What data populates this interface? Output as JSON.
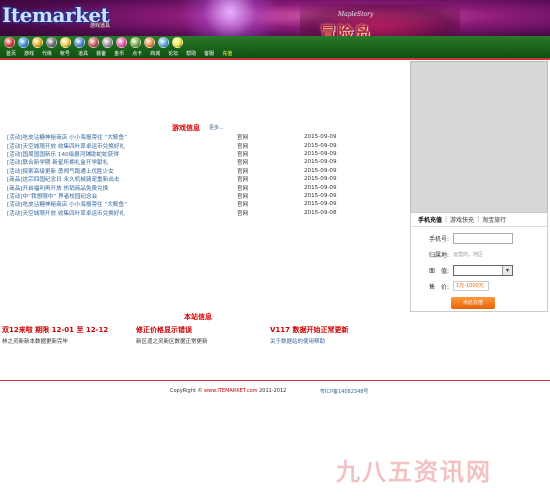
{
  "header": {
    "logo": "Itemarket",
    "logo_sub": "游戏道具",
    "game_logo": "MapleStory",
    "banner_text": "冒险岛"
  },
  "nav": {
    "icons": [
      "home-icon",
      "gem-icon",
      "coin-icon",
      "shield-icon",
      "star-icon",
      "ball-icon",
      "shop-icon",
      "sword-icon",
      "gift-icon",
      "bag-icon",
      "cup-icon",
      "ring-icon",
      "crown-icon"
    ],
    "icon_colors": [
      "#d33",
      "#3a8ee0",
      "#e8b020",
      "#6a6a6a",
      "#f4d040",
      "#48c",
      "#c55",
      "#999",
      "#e5a",
      "#7a4",
      "#e84",
      "#5ad",
      "#ee3"
    ],
    "links": [
      "首页",
      "游戏",
      "代练",
      "帐号",
      "道具",
      "装备",
      "金币",
      "点卡",
      "商城",
      "论坛",
      "帮助",
      "客服",
      "充值"
    ]
  },
  "news": {
    "title": "游戏信息",
    "more": "更多...",
    "items": [
      {
        "title": "[活动]吃皮沾糖神秘商店 小小海报旁往 “大鲸鱼”",
        "source": "官网",
        "date": "2015-09-09"
      },
      {
        "title": "[活动]天空城限开放 收集四叶草卓运币兑换好礼",
        "source": "官网",
        "date": "2015-09-09"
      },
      {
        "title": "[活动]国周国国新乐 140级爵河铺助蛇蛇获得",
        "source": "官网",
        "date": "2015-09-09"
      },
      {
        "title": "[活动]联合新学期 新星所拥礼盒开学献礼",
        "source": "官网",
        "date": "2015-09-09"
      },
      {
        "title": "[活动]探索高级更新 勇闯气跑通上优胜少女",
        "source": "官网",
        "date": "2015-09-09"
      },
      {
        "title": "[商品]这宗四国纪念日 永久机械骑宠重新出击",
        "source": "官网",
        "date": "2015-09-09"
      },
      {
        "title": "[商品]开启福利再开放 热销商品免费兑换",
        "source": "官网",
        "date": "2015-09-09"
      },
      {
        "title": "[活动]中“我想限中”  界者校园纪念会",
        "source": "官网",
        "date": "2015-09-09"
      },
      {
        "title": "[活动]吃皮沾糖神秘商店 小小海报旁往 “大鲸鱼”",
        "source": "官网",
        "date": "2015-09-09"
      },
      {
        "title": "[活动]天空城限开放 收集四叶草卓运币兑换好礼",
        "source": "官网",
        "date": "2015-09-08"
      }
    ]
  },
  "site_info": {
    "title": "本站信息",
    "notices": [
      {
        "head": "双12来啦 期限 12-01 至 12-12",
        "sub": "林之灵新新本数据更新完毕",
        "link": false
      },
      {
        "head": "修正价格显示错误",
        "sub": "新区遗之灵新区数据正常更新",
        "link": false
      },
      {
        "head": "V117 数据开始正常更新",
        "sub": "关于数据站的使用帮助",
        "link": true
      }
    ]
  },
  "recharge": {
    "tabs": [
      "手机充值",
      "游戏快充",
      "淘宝旅行"
    ],
    "phone_label": "手机号:",
    "phone_value": "",
    "region_label": "归属地:",
    "region_value": "运营商，地区",
    "amount_label": "面　值:",
    "amount_value": "",
    "price_label": "售　价:",
    "price_value": "1元-1000元",
    "button": "点此充值"
  },
  "footer": {
    "copyright_prefix": "CopyRight © ",
    "site": "www.ITEMARKET.com",
    "years": " 2011-2012",
    "icp": "粤ICP备14082348号"
  },
  "watermark": "九八五资讯网"
}
